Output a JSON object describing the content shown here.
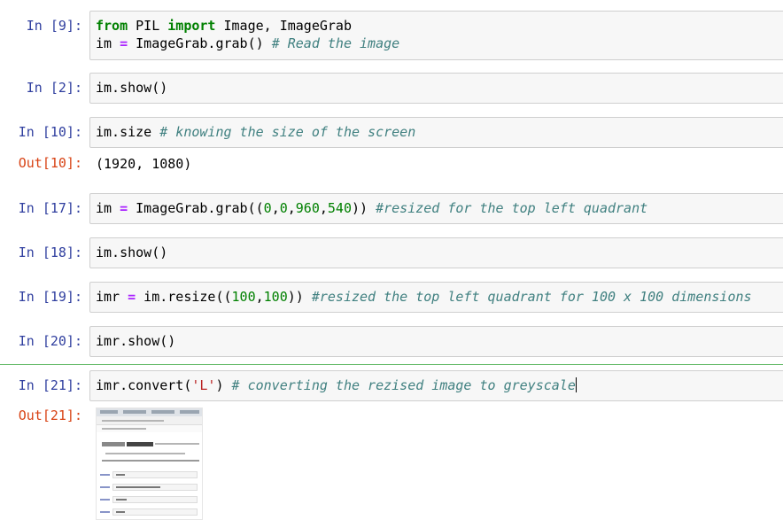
{
  "cells": [
    {
      "id": "cell-9",
      "prompt": "In [9]:",
      "lines": [
        [
          {
            "t": "kw",
            "v": "from"
          },
          {
            "t": "plain",
            "v": " PIL "
          },
          {
            "t": "kw",
            "v": "import"
          },
          {
            "t": "plain",
            "v": " Image, ImageGrab"
          }
        ],
        [
          {
            "t": "plain",
            "v": "im "
          },
          {
            "t": "op",
            "v": "="
          },
          {
            "t": "plain",
            "v": " ImageGrab.grab() "
          },
          {
            "t": "com",
            "v": "# Read the image"
          }
        ]
      ]
    },
    {
      "id": "cell-2",
      "prompt": "In [2]:",
      "lines": [
        [
          {
            "t": "plain",
            "v": "im.show()"
          }
        ]
      ]
    },
    {
      "id": "cell-10",
      "prompt": "In [10]:",
      "lines": [
        [
          {
            "t": "plain",
            "v": "im.size "
          },
          {
            "t": "com",
            "v": "# knowing the size of the screen"
          }
        ]
      ],
      "output_prompt": "Out[10]:",
      "output_text": "(1920, 1080)"
    },
    {
      "id": "cell-17",
      "prompt": "In [17]:",
      "lines": [
        [
          {
            "t": "plain",
            "v": "im "
          },
          {
            "t": "op",
            "v": "="
          },
          {
            "t": "plain",
            "v": " ImageGrab.grab(("
          },
          {
            "t": "num",
            "v": "0"
          },
          {
            "t": "plain",
            "v": ","
          },
          {
            "t": "num",
            "v": "0"
          },
          {
            "t": "plain",
            "v": ","
          },
          {
            "t": "num",
            "v": "960"
          },
          {
            "t": "plain",
            "v": ","
          },
          {
            "t": "num",
            "v": "540"
          },
          {
            "t": "plain",
            "v": ")) "
          },
          {
            "t": "com",
            "v": "#resized for the top left quadrant"
          }
        ]
      ]
    },
    {
      "id": "cell-18",
      "prompt": "In [18]:",
      "lines": [
        [
          {
            "t": "plain",
            "v": "im.show()"
          }
        ]
      ]
    },
    {
      "id": "cell-19",
      "prompt": "In [19]:",
      "lines": [
        [
          {
            "t": "plain",
            "v": "imr "
          },
          {
            "t": "op",
            "v": "="
          },
          {
            "t": "plain",
            "v": " im.resize(("
          },
          {
            "t": "num",
            "v": "100"
          },
          {
            "t": "plain",
            "v": ","
          },
          {
            "t": "num",
            "v": "100"
          },
          {
            "t": "plain",
            "v": ")) "
          },
          {
            "t": "com",
            "v": "#resized the top left quadrant for 100 x 100 dimensions"
          }
        ]
      ]
    },
    {
      "id": "cell-20",
      "prompt": "In [20]:",
      "lines": [
        [
          {
            "t": "plain",
            "v": "imr.show()"
          }
        ]
      ]
    },
    {
      "id": "cell-21",
      "prompt": "In [21]:",
      "selected": true,
      "lines": [
        [
          {
            "t": "plain",
            "v": "imr.convert("
          },
          {
            "t": "str",
            "v": "'L'"
          },
          {
            "t": "plain",
            "v": ") "
          },
          {
            "t": "com",
            "v": "# converting the rezised image to greyscale"
          }
        ]
      ],
      "output_prompt": "Out[21]:",
      "output_image": "screenshot-thumbnail"
    }
  ],
  "colors": {
    "in_prompt": "#303f9f",
    "out_prompt": "#d84315",
    "keyword": "#008000",
    "operator": "#aa22ff",
    "number": "#008000",
    "string": "#ba2121",
    "comment": "#408080",
    "input_bg": "#f7f7f7",
    "selected_bar": "#66bb6a"
  }
}
